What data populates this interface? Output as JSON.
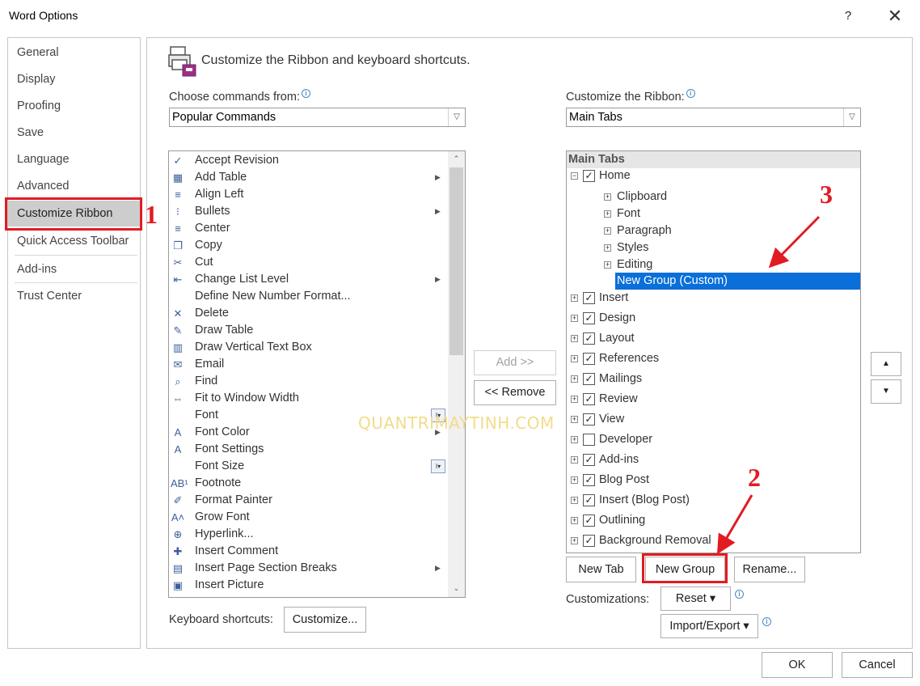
{
  "window": {
    "title": "Word Options",
    "help_label": "?",
    "close_label": "✕"
  },
  "nav": {
    "items": [
      {
        "label": "General"
      },
      {
        "label": "Display"
      },
      {
        "label": "Proofing"
      },
      {
        "label": "Save"
      },
      {
        "label": "Language"
      },
      {
        "label": "Advanced"
      },
      {
        "label": "Customize Ribbon"
      },
      {
        "label": "Quick Access Toolbar"
      },
      {
        "label": "Add-ins"
      },
      {
        "label": "Trust Center"
      }
    ],
    "selected": "Customize Ribbon"
  },
  "header": {
    "title": "Customize the Ribbon and keyboard shortcuts."
  },
  "left": {
    "choose_label": "Choose commands from:",
    "choose_value": "Popular Commands",
    "commands": [
      {
        "label": "Accept Revision",
        "icon": "✓"
      },
      {
        "label": "Add Table",
        "icon": "▦"
      },
      {
        "label": "Align Left",
        "icon": "≡"
      },
      {
        "label": "Bullets",
        "icon": "⁝"
      },
      {
        "label": "Center",
        "icon": "≡"
      },
      {
        "label": "Copy",
        "icon": "❐"
      },
      {
        "label": "Cut",
        "icon": "✂"
      },
      {
        "label": "Change List Level",
        "icon": "⇤"
      },
      {
        "label": "Define New Number Format...",
        "icon": ""
      },
      {
        "label": "Delete",
        "icon": "✕"
      },
      {
        "label": "Draw Table",
        "icon": "✎"
      },
      {
        "label": "Draw Vertical Text Box",
        "icon": "▥"
      },
      {
        "label": "Email",
        "icon": "✉"
      },
      {
        "label": "Find",
        "icon": "⌕"
      },
      {
        "label": "Fit to Window Width",
        "icon": "⇔"
      },
      {
        "label": "Font",
        "icon": ""
      },
      {
        "label": "Font Color",
        "icon": "A"
      },
      {
        "label": "Font Settings",
        "icon": "A"
      },
      {
        "label": "Font Size",
        "icon": ""
      },
      {
        "label": "Footnote",
        "icon": "AB¹"
      },
      {
        "label": "Format Painter",
        "icon": "✐"
      },
      {
        "label": "Grow Font",
        "icon": "A˄"
      },
      {
        "label": "Hyperlink...",
        "icon": "⊕"
      },
      {
        "label": "Insert Comment",
        "icon": "✚"
      },
      {
        "label": "Insert Page  Section Breaks",
        "icon": "▤"
      },
      {
        "label": "Insert Picture",
        "icon": "▣"
      }
    ],
    "keyboard_label": "Keyboard shortcuts:",
    "customize_button": "Customize..."
  },
  "middle": {
    "add_button": "Add >>",
    "remove_button": "<< Remove"
  },
  "right": {
    "customize_label": "Customize the Ribbon:",
    "customize_value": "Main Tabs",
    "tree_header": "Main Tabs",
    "home": "Home",
    "home_groups": [
      "Clipboard",
      "Font",
      "Paragraph",
      "Styles",
      "Editing"
    ],
    "new_group_item": "New Group (Custom)",
    "tabs": [
      {
        "label": "Insert",
        "checked": true
      },
      {
        "label": "Design",
        "checked": true
      },
      {
        "label": "Layout",
        "checked": true
      },
      {
        "label": "References",
        "checked": true
      },
      {
        "label": "Mailings",
        "checked": true
      },
      {
        "label": "Review",
        "checked": true
      },
      {
        "label": "View",
        "checked": true
      },
      {
        "label": "Developer",
        "checked": false
      },
      {
        "label": "Add-ins",
        "checked": true
      },
      {
        "label": "Blog Post",
        "checked": true
      },
      {
        "label": "Insert (Blog Post)",
        "checked": true
      },
      {
        "label": "Outlining",
        "checked": true
      },
      {
        "label": "Background Removal",
        "checked": true
      }
    ],
    "new_tab_button": "New Tab",
    "new_group_button": "New Group",
    "rename_button": "Rename...",
    "customizations_label": "Customizations:",
    "reset_button": "Reset ▾",
    "import_export_button": "Import/Export ▾"
  },
  "footer": {
    "ok_button": "OK",
    "cancel_button": "Cancel"
  },
  "annotations": {
    "step1": "1",
    "step2": "2",
    "step3": "3",
    "annotation_color": "#e21b23"
  },
  "watermark": "QUANTRIMAYTINH.COM",
  "colors": {
    "selection": "#0a6fd8",
    "nav_selected": "#cdcdcd"
  }
}
